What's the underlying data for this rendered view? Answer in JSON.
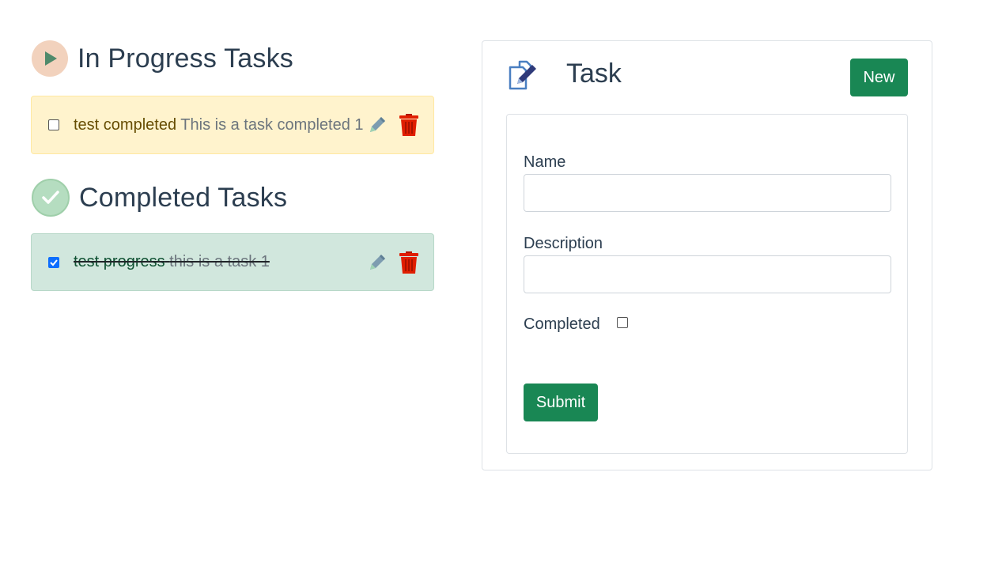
{
  "in_progress": {
    "heading": "In Progress Tasks",
    "tasks": [
      {
        "name": "test completed",
        "description": "This is a task completed 1",
        "checked": false
      }
    ]
  },
  "completed": {
    "heading": "Completed Tasks",
    "tasks": [
      {
        "name": "test progress",
        "description": "this is a task 1",
        "checked": true
      }
    ]
  },
  "task_card": {
    "title": "Task",
    "new_label": "New",
    "form": {
      "name_label": "Name",
      "name_value": "",
      "description_label": "Description",
      "description_value": "",
      "completed_label": "Completed",
      "completed_checked": false,
      "submit_label": "Submit"
    }
  },
  "colors": {
    "primary_green": "#198754",
    "inprogress_bg": "#fff3cd",
    "completed_bg": "#d1e7dd",
    "trash_red": "#e01e00",
    "checkbox_blue": "#0d6efd"
  },
  "icons": {
    "in_progress": "play-icon",
    "completed": "check-icon",
    "edit": "pencil-icon",
    "delete": "trash-icon",
    "task": "edit-document-icon"
  }
}
